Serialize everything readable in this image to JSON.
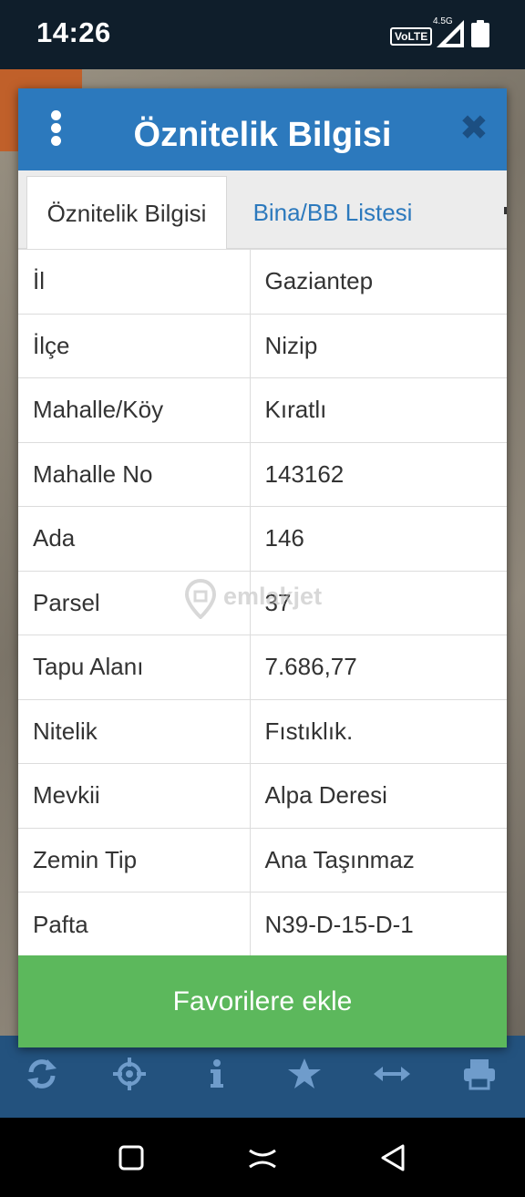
{
  "status_bar": {
    "time": "14:26",
    "volte": "VoLTE",
    "network": "4.5G"
  },
  "dialog": {
    "title": "Öznitelik Bilgisi",
    "menu_icon": "more-vertical-icon",
    "close_icon": "close-icon",
    "tabs": [
      {
        "label": "Öznitelik Bilgisi",
        "active": true
      },
      {
        "label": "Bina/BB Listesi",
        "active": false
      }
    ],
    "rows": [
      {
        "key": "İl",
        "value": "Gaziantep"
      },
      {
        "key": "İlçe",
        "value": "Nizip"
      },
      {
        "key": "Mahalle/Köy",
        "value": "Kıratlı"
      },
      {
        "key": "Mahalle No",
        "value": "143162"
      },
      {
        "key": "Ada",
        "value": "146"
      },
      {
        "key": "Parsel",
        "value": "37"
      },
      {
        "key": "Tapu Alanı",
        "value": "7.686,77"
      },
      {
        "key": "Nitelik",
        "value": "Fıstıklık."
      },
      {
        "key": "Mevkii",
        "value": "Alpa Deresi"
      },
      {
        "key": "Zemin Tip",
        "value": "Ana Taşınmaz"
      },
      {
        "key": "Pafta",
        "value": "N39-D-15-D-1"
      }
    ],
    "favorite_button": "Favorilere ekle"
  },
  "watermark": "emlakjet",
  "toolbar_icons": [
    "refresh-icon",
    "locate-icon",
    "info-icon",
    "star-icon",
    "measure-icon",
    "print-icon"
  ],
  "nav_icons": [
    "recents-icon",
    "home-icon",
    "back-icon"
  ],
  "colors": {
    "header": "#2c79bd",
    "toolbar": "#23527e",
    "toolbar_icon": "#6f9ccb",
    "favorite_button": "#5cb85c",
    "tab_link": "#2c79bd"
  }
}
